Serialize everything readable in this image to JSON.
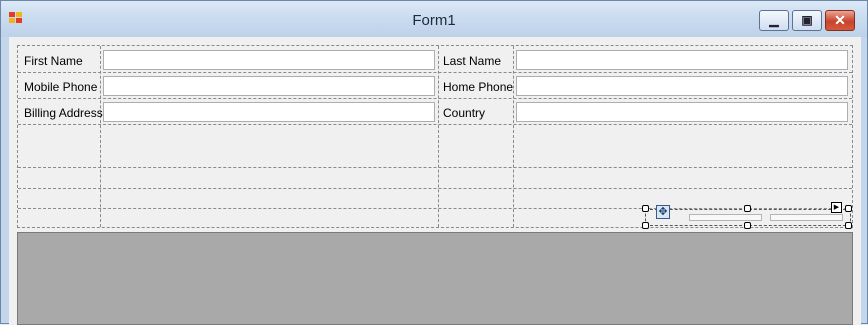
{
  "window": {
    "title": "Form1"
  },
  "colors": {
    "titlebar": "#c9dbef",
    "client": "#f0f0f0",
    "bottom_panel": "#a9a9a9",
    "close_button": "#c8442c"
  },
  "controls": {
    "minimize_icon": "minimize-icon",
    "maximize_icon": "maximize-icon",
    "close_icon": "close-icon"
  },
  "form": {
    "first_name_label": "First Name",
    "last_name_label": "Last Name",
    "mobile_phone_label": "Mobile Phone",
    "home_phone_label": "Home Phone",
    "billing_address_label": "Billing Address",
    "country_label": "Country",
    "first_name_value": "",
    "last_name_value": "",
    "mobile_phone_value": "",
    "home_phone_value": "",
    "billing_address_value": "",
    "country_value": ""
  }
}
